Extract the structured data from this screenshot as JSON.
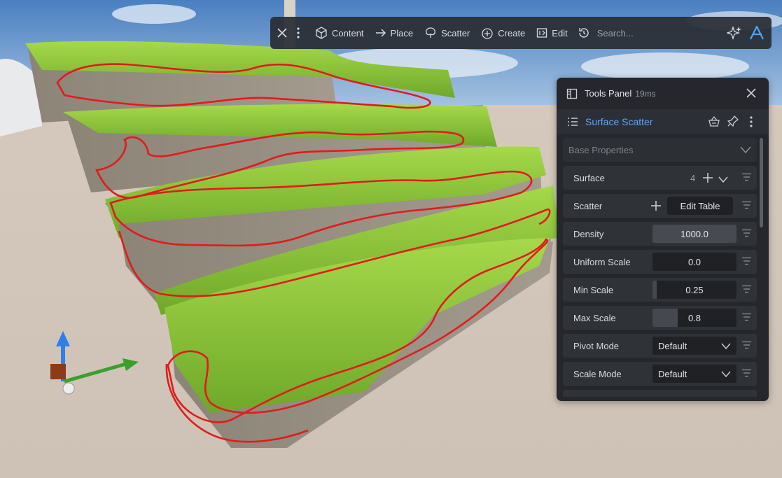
{
  "toolbar": {
    "items": [
      {
        "label": "Content",
        "icon": "cube-icon"
      },
      {
        "label": "Place",
        "icon": "arrow-right-icon"
      },
      {
        "label": "Scatter",
        "icon": "tree-icon"
      },
      {
        "label": "Create",
        "icon": "add-circle-icon"
      },
      {
        "label": "Edit",
        "icon": "edit-icon"
      }
    ],
    "search_placeholder": "Search..."
  },
  "panel": {
    "title": "Tools Panel",
    "timing": "19ms",
    "tool_name": "Surface Scatter",
    "section_title": "Base Properties",
    "properties": {
      "surface": {
        "label": "Surface",
        "value": "4"
      },
      "scatter": {
        "label": "Scatter",
        "button": "Edit Table"
      },
      "density": {
        "label": "Density",
        "value": "1000.0"
      },
      "uniform_scale": {
        "label": "Uniform Scale",
        "value": "0.0"
      },
      "min_scale": {
        "label": "Min Scale",
        "value": "0.25",
        "level": 0.05
      },
      "max_scale": {
        "label": "Max Scale",
        "value": "0.8",
        "level": 0.3
      },
      "pivot_mode": {
        "label": "Pivot Mode",
        "value": "Default"
      },
      "scale_mode": {
        "label": "Scale Mode",
        "value": "Default"
      }
    }
  },
  "colors": {
    "accent": "#5aa9ff",
    "panel_bg": "#25272c",
    "annotation": "#e11b1b",
    "grass": "#8bc53a"
  }
}
